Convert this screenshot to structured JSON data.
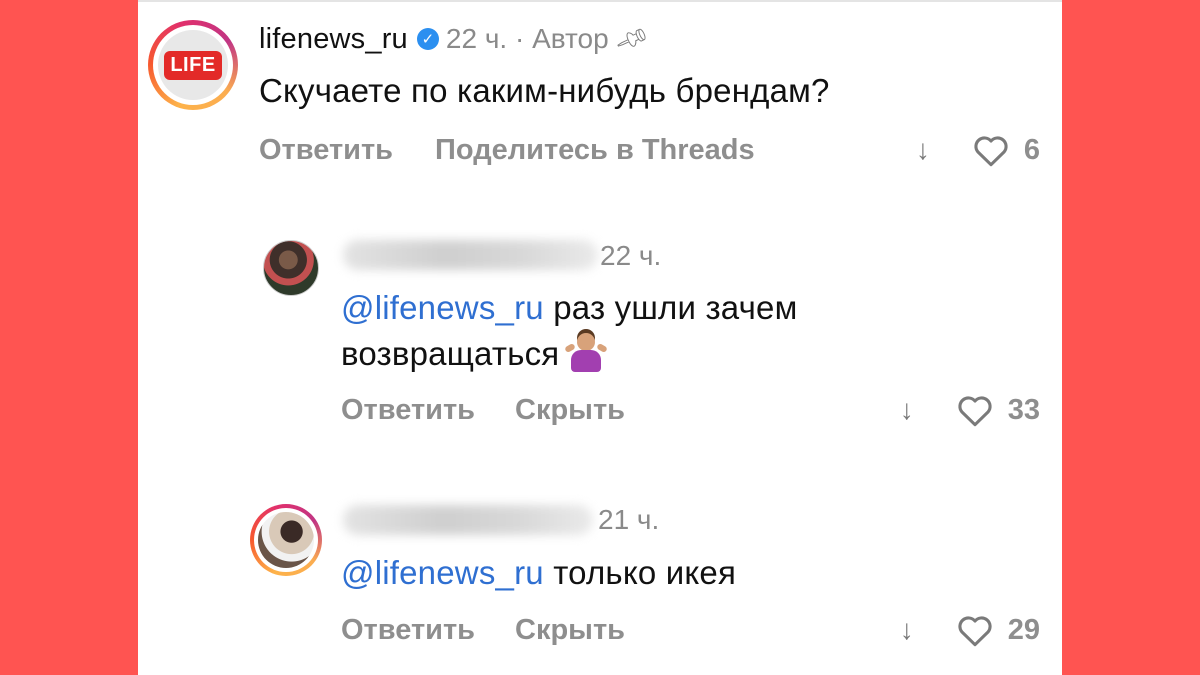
{
  "colors": {
    "background": "#ff5451",
    "panel": "#ffffff",
    "mention": "#2f6fd1",
    "verified": "#2b8ff0",
    "muted": "#8e8e8e"
  },
  "comments": [
    {
      "username": "lifenews_ru",
      "avatar_logo": "LIFE",
      "verified_icon": "verified-badge-icon",
      "time": "22 ч.",
      "separator": "·",
      "author_label": "Автор",
      "pin_icon": "pin-icon",
      "text": "Скучаете по каким-нибудь брендам?",
      "actions": {
        "reply": "Ответить",
        "share": "Поделитесь в Threads"
      },
      "likes": "6"
    },
    {
      "username_hidden": true,
      "time": "22 ч.",
      "mention": "@lifenews_ru",
      "text_line1": "раз ушли зачем",
      "text_line2": "возвращаться",
      "emoji": "person-shrugging-emoji",
      "actions": {
        "reply": "Ответить",
        "hide": "Скрыть"
      },
      "likes": "33"
    },
    {
      "username_hidden": true,
      "time": "21 ч.",
      "mention": "@lifenews_ru",
      "text": "только икея",
      "actions": {
        "reply": "Ответить",
        "hide": "Скрыть"
      },
      "likes": "29"
    }
  ]
}
